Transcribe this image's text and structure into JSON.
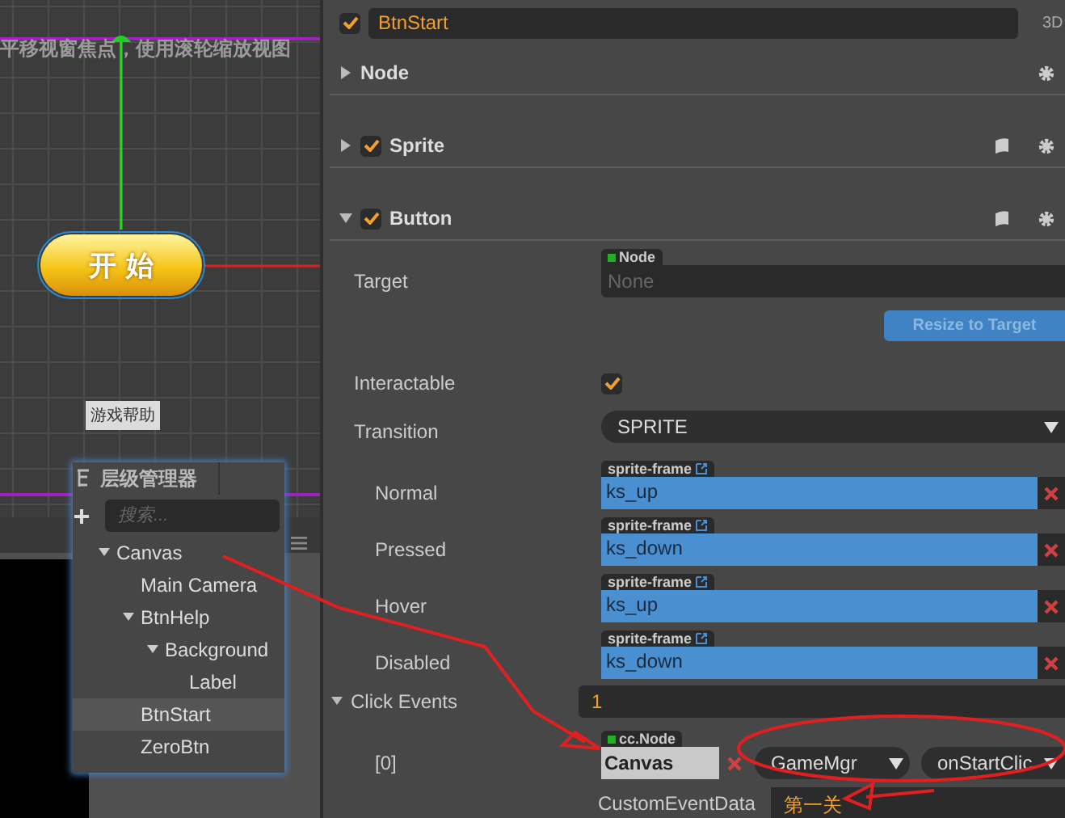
{
  "scene": {
    "hint": "平移视窗焦点，使用滚轮缩放视图",
    "start_label": "开 始",
    "help_label": "游戏帮助"
  },
  "hierarchy": {
    "title": "层级管理器",
    "search": {
      "placeholder": "搜索..."
    },
    "tree": [
      {
        "label": "Canvas",
        "expanded": true,
        "selected": false,
        "children": [
          {
            "label": "Main Camera",
            "selected": false
          },
          {
            "label": "BtnHelp",
            "expanded": true,
            "selected": false,
            "children": [
              {
                "label": "Background",
                "expanded": true,
                "selected": false,
                "children": [
                  {
                    "label": "Label",
                    "selected": false
                  }
                ]
              }
            ]
          },
          {
            "label": "BtnStart",
            "selected": true
          },
          {
            "label": "ZeroBtn",
            "selected": false
          }
        ]
      }
    ]
  },
  "inspector": {
    "node": {
      "active": true,
      "name": "BtnStart",
      "mode": "3D"
    },
    "components": [
      {
        "kind": "node",
        "title": "Node",
        "expanded": false
      },
      {
        "kind": "component",
        "title": "Sprite",
        "expanded": false,
        "enabled": true
      },
      {
        "kind": "component",
        "title": "Button",
        "expanded": true,
        "enabled": true
      }
    ],
    "button": {
      "target": {
        "label": "Target",
        "tag": "Node",
        "placeholder": "None"
      },
      "resize": {
        "label": "Resize to Target",
        "disabled": true
      },
      "interactable": {
        "label": "Interactable",
        "checked": true
      },
      "transition": {
        "label": "Transition",
        "value": "SPRITE"
      },
      "frames": [
        {
          "label": "Normal",
          "tag": "sprite-frame",
          "value": "ks_up"
        },
        {
          "label": "Pressed",
          "tag": "sprite-frame",
          "value": "ks_down"
        },
        {
          "label": "Hover",
          "tag": "sprite-frame",
          "value": "ks_up"
        },
        {
          "label": "Disabled",
          "tag": "sprite-frame",
          "value": "ks_down"
        }
      ],
      "click_events": {
        "label": "Click Events",
        "expanded": true,
        "count": "1",
        "events": [
          {
            "index": "[0]",
            "tag": "cc.Node",
            "target": "Canvas",
            "component": "GameMgr",
            "handler": "onStartClic",
            "data_label": "CustomEventData",
            "data_value": "第一关"
          }
        ]
      }
    }
  }
}
